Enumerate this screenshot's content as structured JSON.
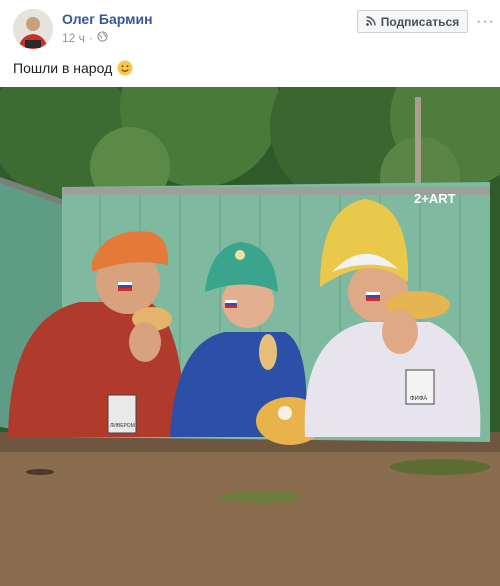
{
  "post": {
    "author": "Олег Бармин",
    "time": "12 ч",
    "audience_icon": "globe-icon",
    "subscribe_label": "Подписаться",
    "subscribe_icon": "rss-icon",
    "more_icon": "more-dots-icon",
    "text": "Пошли в народ",
    "emoji": "smile-emoji",
    "photo": {
      "artist_tag": "2+ART",
      "badge_left": "ЛИВЕРОМ",
      "badge_right": "ФИФА"
    }
  }
}
